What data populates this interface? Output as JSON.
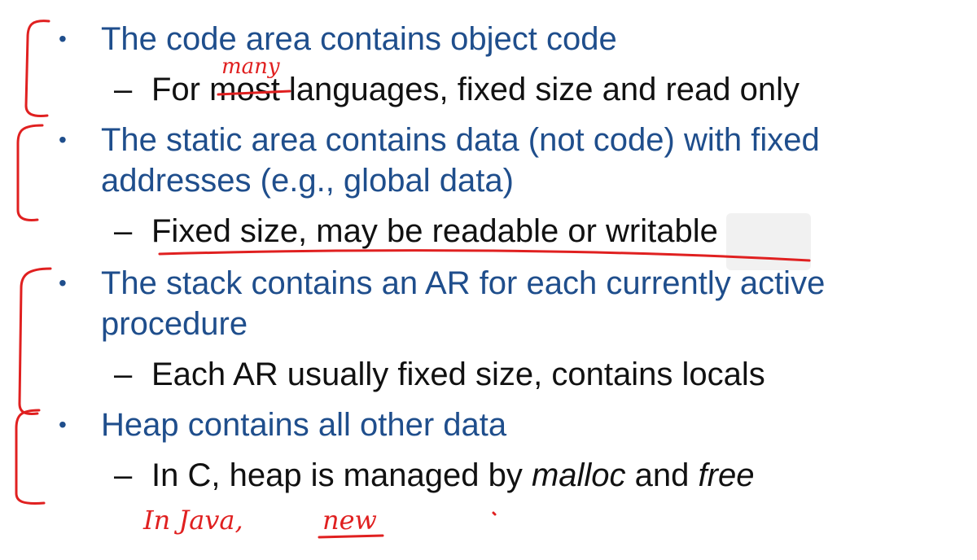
{
  "bullets": [
    {
      "text": "The code area contains object code",
      "sub": [
        "For ",
        "most",
        " languages, fixed size and read only"
      ]
    },
    {
      "line1": "The static area contains data (not code) with fixed",
      "line2": "addresses (e.g., global data)",
      "sub": "Fixed size, may be readable or writable"
    },
    {
      "line1": "The stack contains an AR for each currently active",
      "line2": "procedure",
      "sub": "Each AR usually fixed size, contains locals"
    },
    {
      "text": "Heap contains all other data",
      "sub": {
        "before": "In C, heap is managed by ",
        "malloc": "malloc",
        "mid": " and ",
        "free": "free"
      }
    }
  ],
  "symbols": {
    "bullet": "•",
    "dash": "–"
  },
  "annotations": {
    "many": "many",
    "java_note": "In Java,",
    "new_word": "new"
  },
  "colors": {
    "bullet_text": "#1f4e8c",
    "sub_text": "#111111",
    "ink": "#e02020"
  }
}
